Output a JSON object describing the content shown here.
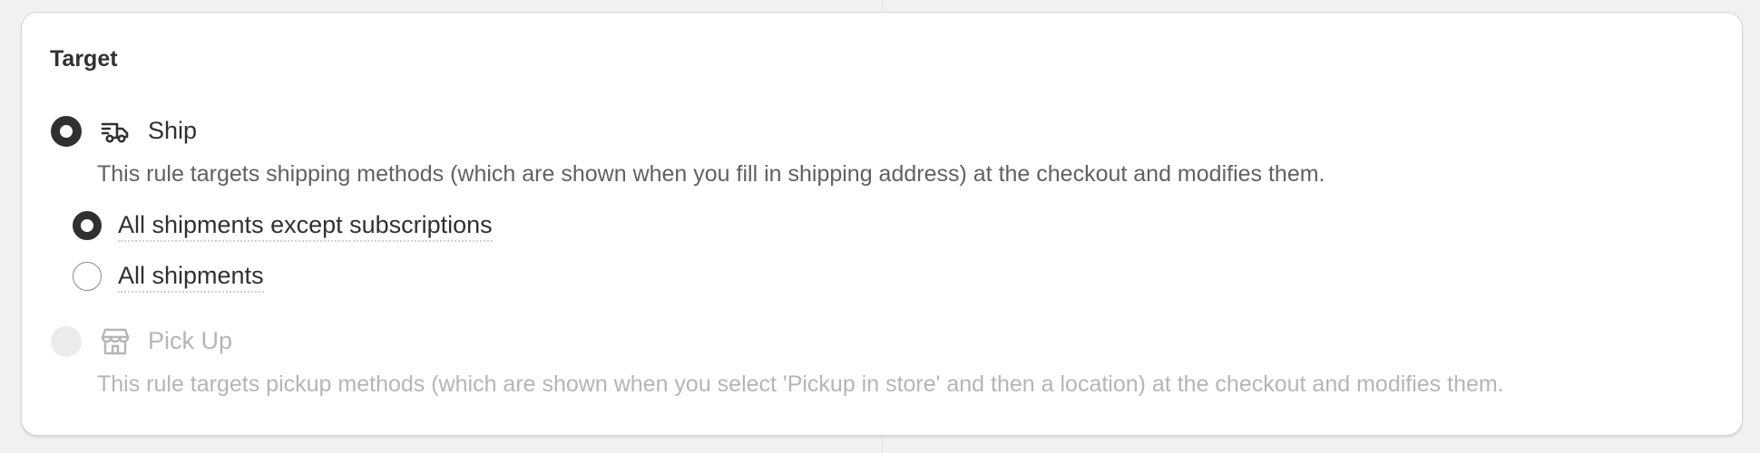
{
  "card": {
    "title": "Target"
  },
  "options": [
    {
      "label": "Ship",
      "icon": "delivery-truck-icon",
      "selected": true,
      "disabled": false,
      "description": "This rule targets shipping methods (which are shown when you fill in shipping address) at the checkout and modifies them.",
      "sub_options": [
        {
          "label": "All shipments except subscriptions",
          "selected": true
        },
        {
          "label": "All shipments",
          "selected": false
        }
      ]
    },
    {
      "label": "Pick Up",
      "icon": "store-icon",
      "selected": false,
      "disabled": true,
      "description": "This rule targets pickup methods (which are shown when you select 'Pickup in store' and then a location) at the checkout and modifies them."
    }
  ],
  "colors": {
    "background": "#f1f1f1",
    "card": "#ffffff",
    "text": "#303030",
    "muted_text": "#616161",
    "disabled_text": "#b5b5b5",
    "disabled_radio": "#ebebeb"
  }
}
